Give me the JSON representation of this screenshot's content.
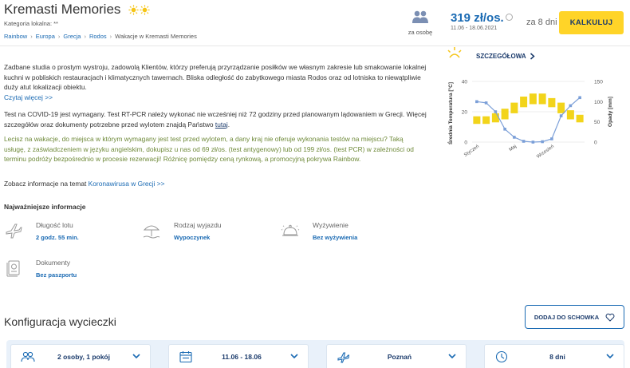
{
  "header": {
    "title": "Kremasti Memories",
    "category": "Kategoria lokalna: **",
    "breadcrumb": [
      "Rainbow",
      "Europa",
      "Grecja",
      "Rodos"
    ],
    "breadcrumb_current": "Wakacje w Kremasti Memories",
    "persons_label": "za osobę",
    "price": "319 zł/os.",
    "price_dates": "11.06 - 18.06.2021",
    "days": "za 8 dni",
    "calculate_button": "KALKULUJ"
  },
  "description": {
    "text": "Zadbane studia o prostym wystroju, zadowolą Klientów, którzy preferują przyrządzanie posiłków we własnym zakresie lub smakowanie lokalnej kuchni w pobliskich restauracjach i klimatycznych tawernach. Bliska odległość do zabytkowego miasta Rodos oraz od lotniska to niewątpliwie duży atut lokalizacji obiektu.",
    "read_more": "Czytaj więcej >>"
  },
  "covid": {
    "text_1": "Test na COVID-19 jest wymagany. Test RT-PCR należy wykonać nie wcześniej niż 72 godziny przed planowanym lądowaniem w Grecji. Więcej szczegółów oraz dokumenty potrzebne przed wylotem znajdą Państwo",
    "link": "tutaj",
    "text_end": ".",
    "promo": "Lecisz na wakacje, do miejsca w którym wymagany jest test przed wylotem, a dany kraj nie oferuje wykonania testów na miejscu? Taką usługę, z zaświadczeniem w języku angielskim, dokupisz u nas od 69 zł/os. (test antygenowy) lub od 199 zł/os. (test PCR) w zależności od terminu podróży bezpośrednio w procesie rezerwacji! Różnicę pomiędzy ceną rynkową, a promocyjną pokrywa Rainbow.",
    "info_prefix": "Zobacz informacje na temat",
    "info_link": "Koronawirusa w Grecji >>"
  },
  "key_info": {
    "title": "Najważniejsze informacje",
    "items": [
      {
        "label": "Długość lotu",
        "value": "2 godz. 55 min.",
        "icon": "airplane-icon"
      },
      {
        "label": "Rodzaj wyjazdu",
        "value": "Wypoczynek",
        "icon": "beach-umbrella-icon"
      },
      {
        "label": "Wyżywienie",
        "value": "Bez wyżywienia",
        "icon": "food-cloche-icon"
      },
      {
        "label": "Dokumenty",
        "value": "Bez paszportu",
        "icon": "passport-icon"
      }
    ]
  },
  "climate": {
    "details_link": "SZCZEGÓŁOWA"
  },
  "chart_data": {
    "type": "bar",
    "ylabel": "Średnia Temperatura [°C]",
    "y2label": "Opady [mm]",
    "ylim": [
      0,
      40
    ],
    "y2lim": [
      0,
      150
    ],
    "yticks": [
      "40",
      "20",
      "0"
    ],
    "y2ticks": [
      "150",
      "100",
      "50",
      "0"
    ],
    "xticks": [
      "Styczeń",
      "Maj",
      "Wrzesień"
    ],
    "categories": [
      "1",
      "2",
      "3",
      "4",
      "5",
      "6",
      "7",
      "8",
      "9",
      "10",
      "11",
      "12"
    ],
    "temperature_ranges": [
      [
        12,
        17
      ],
      [
        12,
        17
      ],
      [
        13,
        19
      ],
      [
        15,
        22
      ],
      [
        19,
        26
      ],
      [
        23,
        30
      ],
      [
        25,
        32
      ],
      [
        25,
        32
      ],
      [
        23,
        29
      ],
      [
        19,
        26
      ],
      [
        15,
        21
      ],
      [
        13,
        18
      ]
    ],
    "precipitation": [
      100,
      97,
      75,
      32,
      12,
      2,
      0,
      1,
      8,
      65,
      90,
      110
    ],
    "temperature_color": "#f2d41a",
    "precipitation_color": "#7b9fd8",
    "grid": true
  },
  "configuration": {
    "title": "Konfiguracja wycieczki",
    "save_button": "DODAJ DO SCHOWKA",
    "fields": [
      {
        "value": "2 osoby, 1 pokój",
        "icon": "people-icon"
      },
      {
        "value": "11.06 - 18.06",
        "icon": "calendar-icon"
      },
      {
        "value": "Poznań",
        "icon": "plane-departure-icon"
      },
      {
        "value": "8 dni",
        "icon": "clock-icon"
      }
    ]
  },
  "colors": {
    "accent": "#1a6ab3",
    "button_yellow": "#ffd428",
    "promo_green": "#6f8a3a",
    "navy": "#1a3a6b"
  }
}
